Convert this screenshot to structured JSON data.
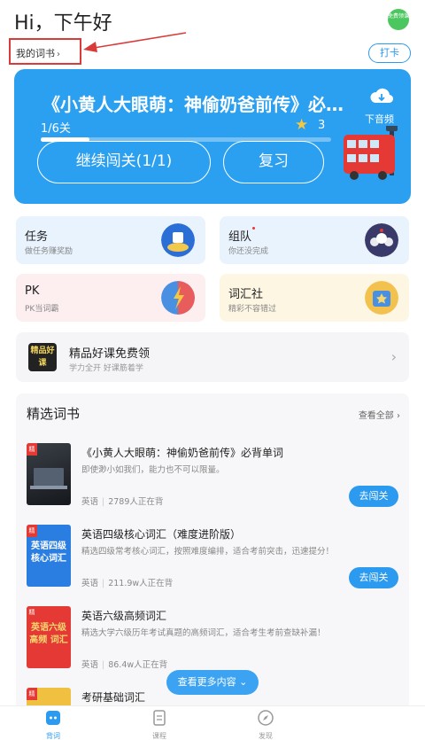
{
  "header": {
    "greeting": "Hi，下午好",
    "free_badge": "免费领课",
    "my_books": "我的词书",
    "checkin": "打卡"
  },
  "hero": {
    "title": "《小黄人大眼萌：神偷奶爸前传》必…",
    "progress_text": "1/6关",
    "progress_fraction": 0.1667,
    "stars": "3",
    "continue": "继续闯关(1/1)",
    "review": "复习",
    "download": "下音频"
  },
  "tiles": [
    {
      "title": "任务",
      "sub": "做任务赚奖励",
      "icon": "task-icon"
    },
    {
      "title": "组队",
      "sub": "你还没完成",
      "icon": "team-icon"
    },
    {
      "title": "PK",
      "sub": "PK当词霸",
      "icon": "pk-icon"
    },
    {
      "title": "词汇社",
      "sub": "精彩不容错过",
      "icon": "club-icon"
    }
  ],
  "promo": {
    "logo": "精品好课",
    "title": "精品好课免费领",
    "sub": "学力全开 好课筋着学"
  },
  "selected": {
    "title": "精选词书",
    "view_all": "查看全部",
    "tag": "精",
    "books": [
      {
        "title": "《小黄人大眼萌：神偷奶爸前传》必背单词",
        "desc": "即使渺小如我们，能力也不可以限量。",
        "lang": "英语",
        "count": "2789人正在背",
        "action": "去闯关",
        "cover": ""
      },
      {
        "title": "英语四级核心词汇（难度进阶版）",
        "desc": "精选四级常考核心词汇，按照难度编排，适合考前突击，迅速提分！",
        "lang": "英语",
        "count": "211.9w人正在背",
        "action": "去闯关",
        "cover": "英语四级 核心词汇"
      },
      {
        "title": "英语六级高频词汇",
        "desc": "精选大学六级历年考试真题的高频词汇，适合考生考前查缺补漏！",
        "lang": "英语",
        "count": "86.4w人正在背",
        "action": "",
        "cover": "英语六级 高频 词汇"
      },
      {
        "title": "考研基础词汇",
        "desc": "",
        "lang": "",
        "count": "",
        "action": "",
        "cover": ""
      }
    ],
    "more": "查看更多内容"
  },
  "tabbar": [
    {
      "label": "背词",
      "icon": "vocab-icon"
    },
    {
      "label": "课程",
      "icon": "course-icon"
    },
    {
      "label": "发现",
      "icon": "discover-icon"
    }
  ],
  "colors": {
    "accent": "#2b9aef",
    "hero": "#2ba0f0",
    "annotation": "#d93a3a"
  }
}
